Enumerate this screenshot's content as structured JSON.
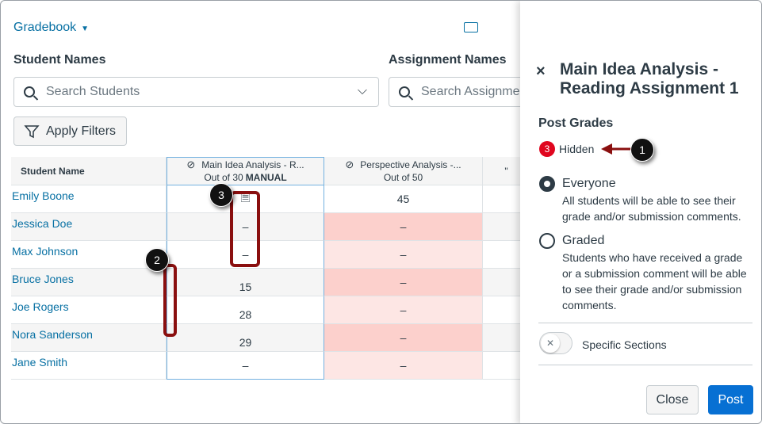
{
  "header": {
    "title": "Gradebook"
  },
  "filters": {
    "student_label": "Student Names",
    "student_placeholder": "Search Students",
    "assignment_label": "Assignment Names",
    "assignment_placeholder": "Search Assignments",
    "apply_label": "Apply Filters"
  },
  "table": {
    "name_header": "Student Name",
    "columns": [
      {
        "title": "Main Idea Analysis - R...",
        "sub": "Out of 30",
        "tag": "MANUAL"
      },
      {
        "title": "Perspective Analysis -...",
        "sub": "Out of 50"
      },
      {
        "title": "\""
      }
    ],
    "rows": [
      {
        "name": "Emily Boone",
        "g1": "",
        "g2": "45"
      },
      {
        "name": "Jessica Doe",
        "g1": "–",
        "g2": "–"
      },
      {
        "name": "Max Johnson",
        "g1": "–",
        "g2": "–"
      },
      {
        "name": "Bruce Jones",
        "g1": "15",
        "g2": "–"
      },
      {
        "name": "Joe Rogers",
        "g1": "28",
        "g2": "–"
      },
      {
        "name": "Nora Sanderson",
        "g1": "29",
        "g2": "–"
      },
      {
        "name": "Jane Smith",
        "g1": "–",
        "g2": "–"
      }
    ]
  },
  "panel": {
    "title": "Main Idea Analysis - Reading Assignment 1",
    "section": "Post Grades",
    "hidden_count": "3",
    "hidden_label": "Hidden",
    "everyone": "Everyone",
    "everyone_desc": "All students will be able to see their grade and/or submission comments.",
    "graded": "Graded",
    "graded_desc": "Students who have received a grade or a submission comment will be able to see their grade and/or submission comments.",
    "specific": "Specific Sections",
    "close": "Close",
    "post": "Post"
  },
  "callouts": [
    "1",
    "2",
    "3"
  ]
}
